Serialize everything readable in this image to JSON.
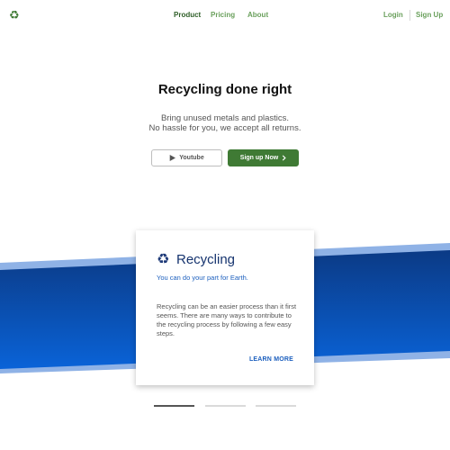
{
  "nav": {
    "logo_icon": "recycle-icon",
    "links": [
      {
        "label": "Product",
        "active": true
      },
      {
        "label": "Pricing",
        "active": false
      },
      {
        "label": "About",
        "active": false
      }
    ],
    "login_label": "Login",
    "signup_label": "Sign Up"
  },
  "hero": {
    "title": "Recycling done right",
    "subtitle_line1": "Bring unused metals and plastics.",
    "subtitle_line2": "No hassle for you, we accept all returns.",
    "youtube_label": "Youtube",
    "youtube_icon": "play-icon",
    "signup_label": "Sign up Now",
    "signup_icon": "chevron-right-icon"
  },
  "card": {
    "icon": "recycle-icon",
    "title": "Recycling",
    "subtitle": "You can do your part for Earth.",
    "body": "Recycling can be an easier process than it first seems. There are many ways to contribute to the recycling process by following a few easy steps.",
    "link_label": "LEARN MORE"
  },
  "carousel": {
    "slides": 3,
    "active_index": 0
  },
  "colors": {
    "brand_green": "#3f7a34",
    "nav_green": "#6aa05c",
    "band_dark_blue": "#0b3a85",
    "band_blue": "#0a63d8",
    "band_light_blue": "#8fb2e6",
    "card_title_navy": "#15336e",
    "link_blue": "#1c5fbe"
  }
}
